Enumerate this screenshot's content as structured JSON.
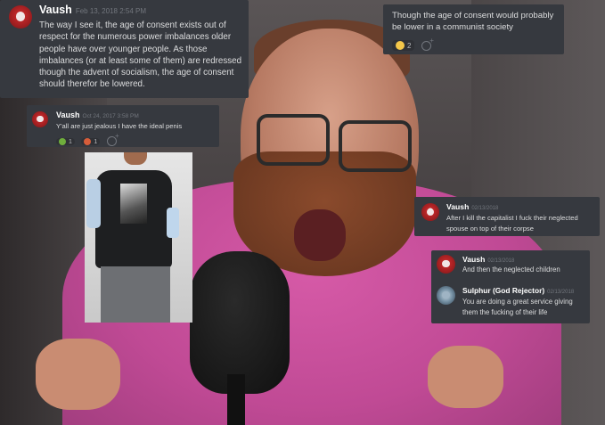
{
  "messages": {
    "card1": {
      "username": "Vaush",
      "timestamp": "Feb 13, 2018 2:54 PM",
      "text": "The way I see it, the age of consent exists out of respect for the numerous power imbalances older people have over younger people. As those imbalances (or at least some of them) are redressed though the advent of socialism, the age of consent should therefor be lowered."
    },
    "card2": {
      "text": "Though the age of consent would probably be lower in a communist society",
      "reaction_count": "2"
    },
    "card3": {
      "username": "Vaush",
      "timestamp": "Oct 24, 2017 3:58 PM",
      "text": "Y'all are just jealous I have the ideal penis",
      "reaction1_count": "1",
      "reaction2_count": "1"
    },
    "card4": {
      "username": "Vaush",
      "timestamp": "02/13/2018",
      "text": "After I kill the capitalist I fuck their neglected spouse on top of their corpse"
    },
    "card5": {
      "username1": "Vaush",
      "timestamp1": "02/13/2018",
      "text1": "And then the neglected children",
      "username2": "Sulphur (God Rejector)",
      "timestamp2": "02/13/2018",
      "text2": "You are doing a great service giving them the fucking of their life"
    }
  },
  "colors": {
    "card_bg": "#36393f",
    "text": "#dcddde",
    "timestamp": "#72767d",
    "shirt": "#c04a95"
  },
  "icons": [
    "avatar-vaush",
    "avatar-sulphur",
    "grimace-emoji",
    "pickle-emoji",
    "popcorn-emoji",
    "add-reaction-icon"
  ]
}
